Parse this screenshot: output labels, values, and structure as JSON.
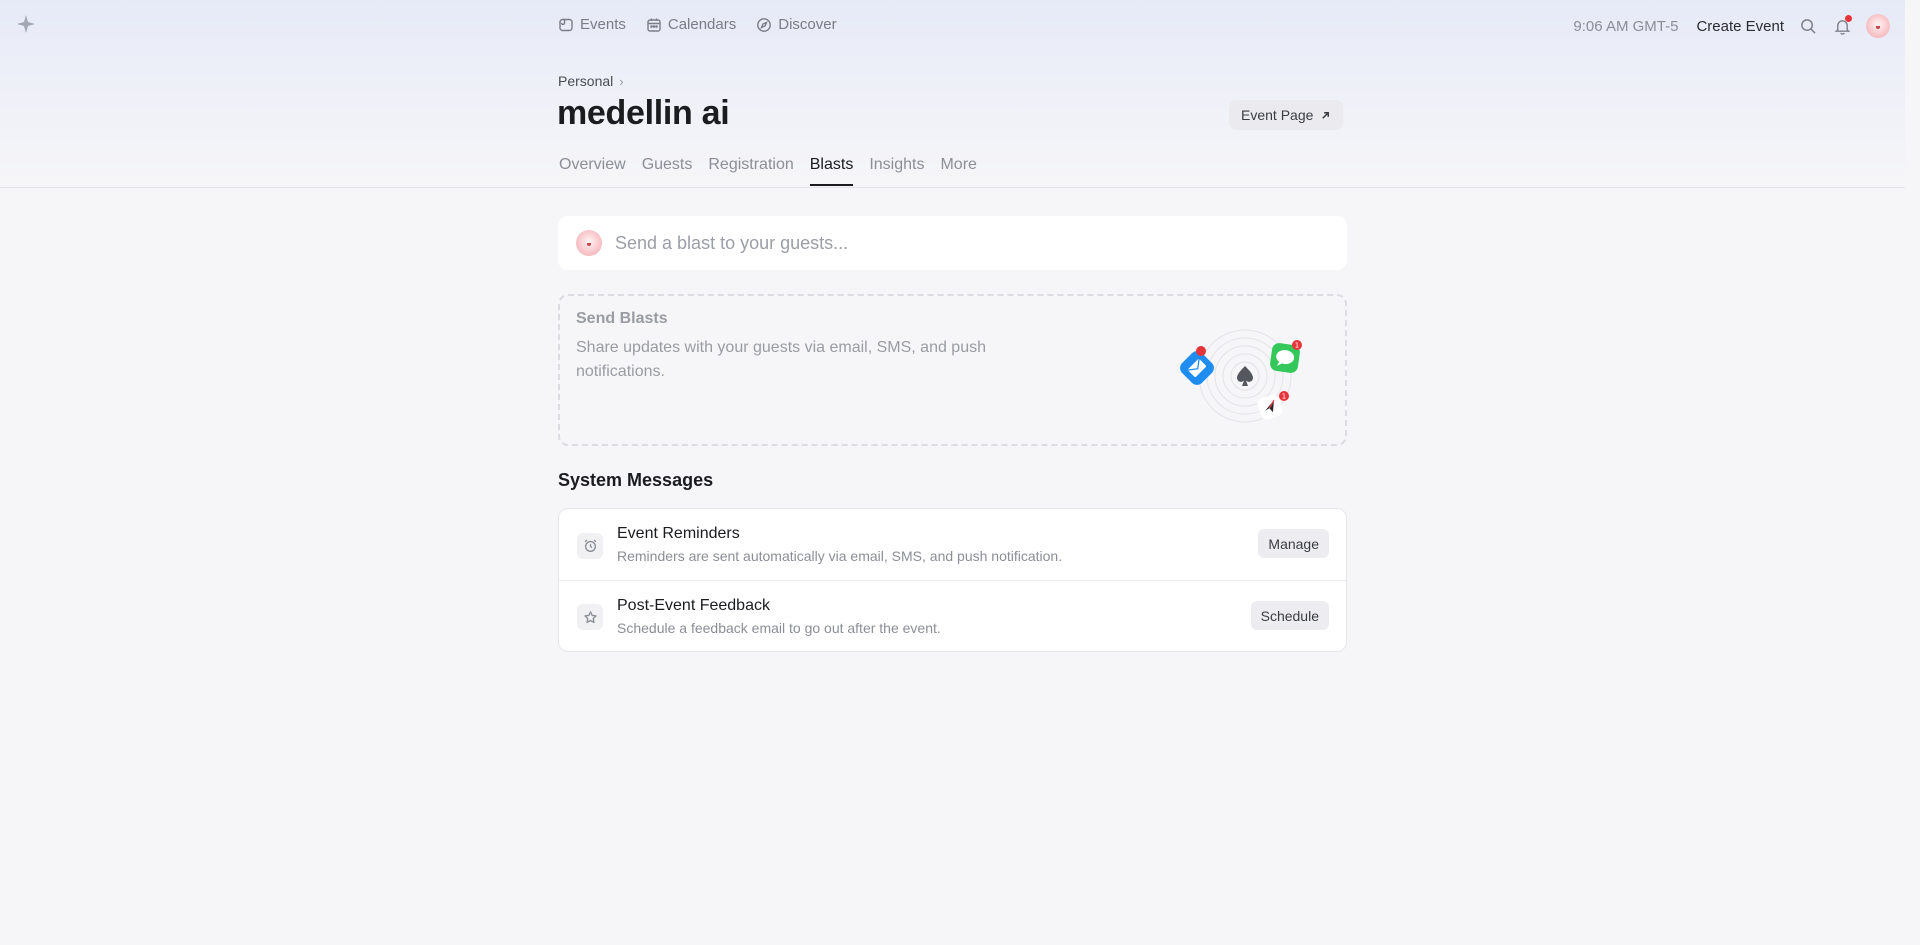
{
  "topnav": {
    "items": [
      {
        "label": "Events",
        "icon": "ticket-icon"
      },
      {
        "label": "Calendars",
        "icon": "calendar-icon"
      },
      {
        "label": "Discover",
        "icon": "compass-icon"
      }
    ],
    "time": "9:06 AM GMT-5",
    "create_event": "Create Event"
  },
  "header": {
    "breadcrumb": "Personal",
    "title": "medellin ai",
    "event_page_button": "Event Page"
  },
  "tabs": [
    "Overview",
    "Guests",
    "Registration",
    "Blasts",
    "Insights",
    "More"
  ],
  "active_tab": "Blasts",
  "compose": {
    "placeholder": "Send a blast to your guests..."
  },
  "send_blasts": {
    "title": "Send Blasts",
    "description": "Share updates with your guests via email, SMS, and push notifications."
  },
  "system_messages": {
    "title": "System Messages",
    "items": [
      {
        "title": "Event Reminders",
        "description": "Reminders are sent automatically via email, SMS, and push notification.",
        "button": "Manage",
        "icon": "alarm-clock-icon"
      },
      {
        "title": "Post-Event Feedback",
        "description": "Schedule a feedback email to go out after the event.",
        "button": "Schedule",
        "icon": "star-icon"
      }
    ]
  },
  "illustration": {
    "badges": [
      "1",
      "1"
    ]
  },
  "colors": {
    "accent": "#1b1c20",
    "notification": "#e5343a",
    "mail_blue": "#1f8cf0",
    "sms_green": "#34c759"
  }
}
